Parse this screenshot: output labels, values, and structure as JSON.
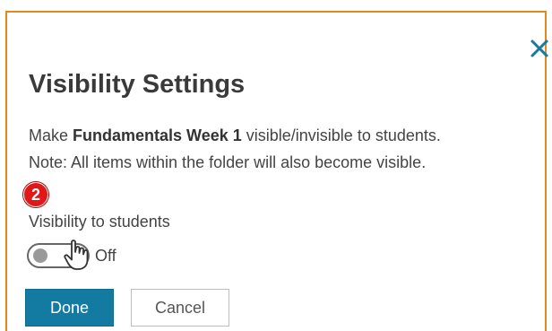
{
  "dialog": {
    "title": "Visibility Settings",
    "description": {
      "prefix": "Make ",
      "folder_name": "Fundamentals Week 1",
      "suffix": " visible/invisible to students.",
      "note": "Note: All items within the folder will also become visible."
    },
    "step_badge": "2",
    "visibility_label": "Visibility to students",
    "toggle": {
      "state_label": "Off",
      "on": false
    },
    "buttons": {
      "done_label": "Done",
      "cancel_label": "Cancel"
    },
    "icons": {
      "close": "close-icon",
      "cursor": "hand-pointer-icon"
    },
    "colors": {
      "frame_border": "#e08a1e",
      "primary_button": "#137aa2",
      "close_icon": "#137aa2",
      "step_badge": "#e01818"
    }
  }
}
